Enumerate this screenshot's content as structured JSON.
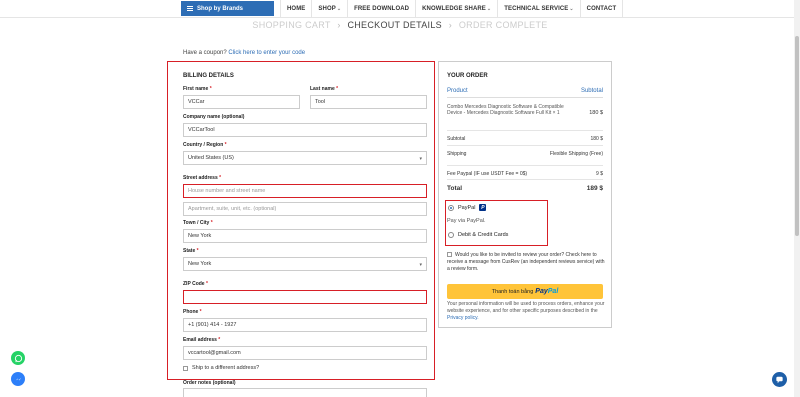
{
  "nav": {
    "brands_label": "Shop by Brands",
    "items": [
      {
        "label": "HOME",
        "caret": ""
      },
      {
        "label": "SHOP",
        "caret": "⌄"
      },
      {
        "label": "FREE DOWNLOAD",
        "caret": ""
      },
      {
        "label": "KNOWLEDGE SHARE",
        "caret": "⌄"
      },
      {
        "label": "TECHNICAL SERVICE",
        "caret": "⌄"
      },
      {
        "label": "CONTACT",
        "caret": ""
      }
    ]
  },
  "steps": {
    "step1": "SHOPPING CART",
    "step2": "CHECKOUT DETAILS",
    "step3": "ORDER COMPLETE",
    "separator": "›"
  },
  "coupon": {
    "text": "Have a coupon?",
    "link": "Click here to enter your code"
  },
  "billing": {
    "title": "BILLING DETAILS",
    "first_name_label": "First name",
    "first_name_value": "VCCar",
    "last_name_label": "Last name",
    "last_name_value": "Tool",
    "company_label": "Company name (optional)",
    "company_value": "VCCarTool",
    "country_label": "Country / Region",
    "country_value": "United States (US)",
    "street_label": "Street address",
    "street_placeholder": "House number and street name",
    "apartment_placeholder": "Apartment, suite, unit, etc. (optional)",
    "town_label": "Town / City",
    "town_value": "New York",
    "state_label": "State",
    "state_value": "New York",
    "zip_label": "ZIP Code",
    "zip_value": "",
    "phone_label": "Phone",
    "phone_value": "+1 (901) 414 - 1927",
    "email_label": "Email address",
    "email_value": "vccartool@gmail.com",
    "ship_diff_label": "Ship to a different address?",
    "notes_label": "Order notes (optional)",
    "required_mark": "*"
  },
  "order": {
    "title": "YOUR ORDER",
    "col_product": "Product",
    "col_subtotal": "Subtotal",
    "product_name": "Combo Mercedes Diagnostic Software & Compatible Device - Mercedes Diagnostic Software Full Kit × 1",
    "product_price": "180 $",
    "subtotal_label": "Subtotal",
    "subtotal_value": "180 $",
    "shipping_label": "Shipping",
    "shipping_value": "Flexible Shipping (Free)",
    "fee_label": "Fee Paypal (IF use USDT Fee = 0$)",
    "fee_value": "9 $",
    "total_label": "Total",
    "total_value": "189 $"
  },
  "payment": {
    "paypal_label": "PayPal",
    "paypal_desc": "Pay via PayPal.",
    "card_label": "Debit & Credit Cards",
    "review_text": "Would you like to be invited to review your order? Check here to receive a message from CusRev (an independent reviews service) with a review form.",
    "button_text": "Thanh toán bằng",
    "button_brand_1": "Pay",
    "button_brand_2": "Pal",
    "privacy_text": "Your personal information will be used to process orders, enhance your website experience, and for other specific purposes described in the",
    "privacy_link": "Privacy policy."
  },
  "colors": {
    "accent": "#2d6db5",
    "highlight_border": "#d71f26",
    "paypal_button": "#ffc439"
  }
}
